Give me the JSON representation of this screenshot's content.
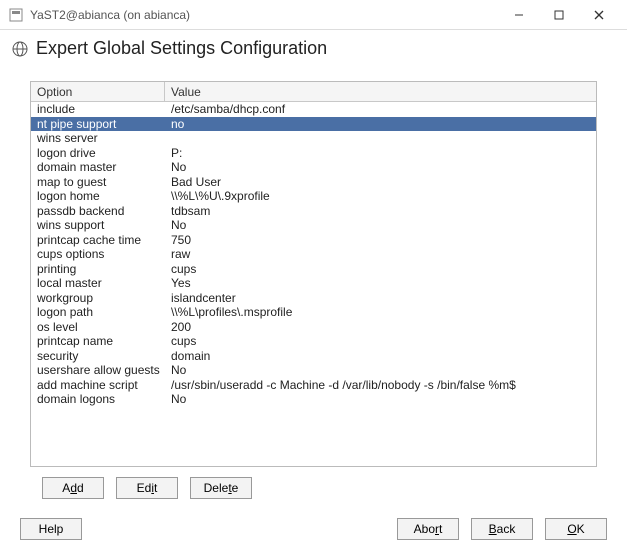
{
  "window": {
    "title": "YaST2@abianca (on abianca)"
  },
  "heading": "Expert Global Settings Configuration",
  "table": {
    "headers": {
      "option": "Option",
      "value": "Value"
    },
    "rows": [
      {
        "option": "include",
        "value": "/etc/samba/dhcp.conf",
        "selected": false
      },
      {
        "option": "nt pipe support",
        "value": "no",
        "selected": true
      },
      {
        "option": "wins server",
        "value": "",
        "selected": false
      },
      {
        "option": "logon drive",
        "value": "P:",
        "selected": false
      },
      {
        "option": "domain master",
        "value": "No",
        "selected": false
      },
      {
        "option": "map to guest",
        "value": "Bad User",
        "selected": false
      },
      {
        "option": "logon home",
        "value": "\\\\%L\\%U\\.9xprofile",
        "selected": false
      },
      {
        "option": "passdb backend",
        "value": "tdbsam",
        "selected": false
      },
      {
        "option": "wins support",
        "value": "No",
        "selected": false
      },
      {
        "option": "printcap cache time",
        "value": "750",
        "selected": false
      },
      {
        "option": "cups options",
        "value": "raw",
        "selected": false
      },
      {
        "option": "printing",
        "value": "cups",
        "selected": false
      },
      {
        "option": "local master",
        "value": "Yes",
        "selected": false
      },
      {
        "option": "workgroup",
        "value": "islandcenter",
        "selected": false
      },
      {
        "option": "logon path",
        "value": "\\\\%L\\profiles\\.msprofile",
        "selected": false
      },
      {
        "option": "os level",
        "value": "200",
        "selected": false
      },
      {
        "option": "printcap name",
        "value": "cups",
        "selected": false
      },
      {
        "option": "security",
        "value": "domain",
        "selected": false
      },
      {
        "option": "usershare allow guests",
        "value": "No",
        "selected": false
      },
      {
        "option": "add machine script",
        "value": "/usr/sbin/useradd  -c Machine -d /var/lib/nobody -s /bin/false %m$",
        "selected": false
      },
      {
        "option": "domain logons",
        "value": "No",
        "selected": false
      }
    ]
  },
  "buttons": {
    "add_pre": "A",
    "add_u": "d",
    "add_post": "d",
    "edit_pre": "Ed",
    "edit_u": "i",
    "edit_post": "t",
    "delete_pre": "Dele",
    "delete_u": "t",
    "delete_post": "e",
    "help": "Help",
    "abort_pre": "Abo",
    "abort_u": "r",
    "abort_post": "t",
    "back_pre": "",
    "back_u": "B",
    "back_post": "ack",
    "ok_pre": "",
    "ok_u": "O",
    "ok_post": "K"
  }
}
